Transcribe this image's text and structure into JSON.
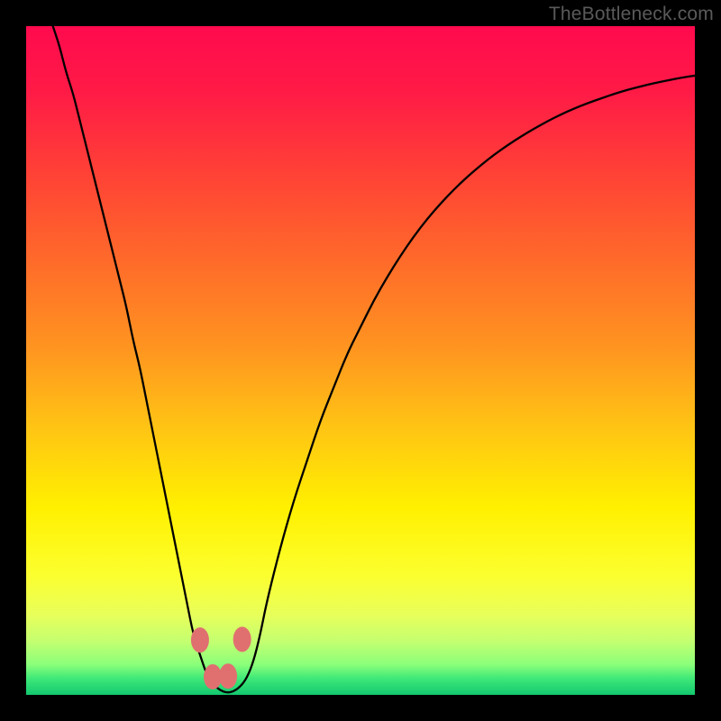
{
  "watermark": "TheBottleneck.com",
  "colors": {
    "gradient": [
      {
        "offset": 0.0,
        "hex": "#ff0a4e"
      },
      {
        "offset": 0.1,
        "hex": "#ff1b46"
      },
      {
        "offset": 0.22,
        "hex": "#ff4136"
      },
      {
        "offset": 0.35,
        "hex": "#ff6a2a"
      },
      {
        "offset": 0.48,
        "hex": "#ff9420"
      },
      {
        "offset": 0.6,
        "hex": "#ffc414"
      },
      {
        "offset": 0.72,
        "hex": "#fff000"
      },
      {
        "offset": 0.82,
        "hex": "#fcff2e"
      },
      {
        "offset": 0.88,
        "hex": "#e8ff5a"
      },
      {
        "offset": 0.92,
        "hex": "#c4ff70"
      },
      {
        "offset": 0.955,
        "hex": "#8aff7a"
      },
      {
        "offset": 0.975,
        "hex": "#40e978"
      },
      {
        "offset": 1.0,
        "hex": "#12c86f"
      }
    ],
    "curve_stroke": "#000000",
    "marker_fill": "#e07070",
    "marker_stroke": "#9c3e3e"
  },
  "chart_data": {
    "type": "line",
    "title": "",
    "xlabel": "",
    "ylabel": "",
    "xlim": [
      0,
      100
    ],
    "ylim": [
      0,
      100
    ],
    "x": [
      4,
      5,
      6,
      7,
      8,
      9,
      10,
      11,
      12,
      13,
      14,
      15,
      16,
      17,
      18,
      19,
      20,
      21,
      22,
      23,
      24,
      25,
      26,
      27,
      28,
      29,
      30,
      31,
      32,
      33,
      34,
      35,
      36,
      38,
      40,
      42,
      44,
      46,
      48,
      50,
      52,
      54,
      56,
      58,
      60,
      62,
      64,
      66,
      68,
      70,
      72,
      74,
      76,
      78,
      80,
      82,
      84,
      86,
      88,
      90,
      92,
      94,
      96,
      98,
      100
    ],
    "values": [
      100,
      97,
      93,
      90,
      86,
      82,
      78,
      74,
      70,
      66,
      62,
      58,
      53,
      49,
      44,
      39,
      34,
      29,
      24,
      19,
      14,
      9,
      6,
      3,
      1.5,
      0.7,
      0.3,
      0.5,
      1.2,
      2.5,
      5,
      9,
      14,
      22,
      29,
      35,
      41,
      46,
      51,
      55,
      59,
      62.5,
      65.7,
      68.6,
      71.2,
      73.5,
      75.6,
      77.5,
      79.2,
      80.8,
      82.2,
      83.5,
      84.7,
      85.8,
      86.8,
      87.7,
      88.5,
      89.2,
      89.9,
      90.5,
      91,
      91.5,
      91.9,
      92.3,
      92.6
    ],
    "markers": [
      {
        "x": 26.0,
        "y": 8.2
      },
      {
        "x": 27.9,
        "y": 2.7
      },
      {
        "x": 30.2,
        "y": 2.8
      },
      {
        "x": 32.3,
        "y": 8.3
      }
    ]
  }
}
